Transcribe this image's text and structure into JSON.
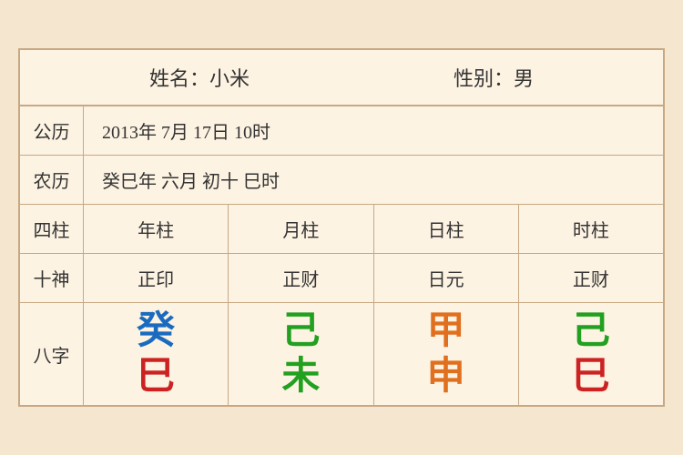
{
  "header": {
    "name_label": "姓名：小米",
    "gender_label": "性别：男"
  },
  "gregorian": {
    "label": "公历",
    "value": "2013年 7月 17日 10时"
  },
  "lunar": {
    "label": "农历",
    "value": "癸巳年 六月 初十 巳时"
  },
  "sizhu": {
    "label": "四柱",
    "columns": [
      "年柱",
      "月柱",
      "日柱",
      "时柱"
    ]
  },
  "shishen": {
    "label": "十神",
    "columns": [
      "正印",
      "正财",
      "日元",
      "正财"
    ]
  },
  "bazi": {
    "label": "八字",
    "columns": [
      {
        "top": "癸",
        "top_color": "color-blue",
        "bottom": "巳",
        "bottom_color": "color-red"
      },
      {
        "top": "己",
        "top_color": "color-green",
        "bottom": "未",
        "bottom_color": "color-green"
      },
      {
        "top": "甲",
        "top_color": "color-orange",
        "bottom": "申",
        "bottom_color": "color-orange"
      },
      {
        "top": "己",
        "top_color": "color-green",
        "bottom": "巳",
        "bottom_color": "color-red"
      }
    ]
  }
}
